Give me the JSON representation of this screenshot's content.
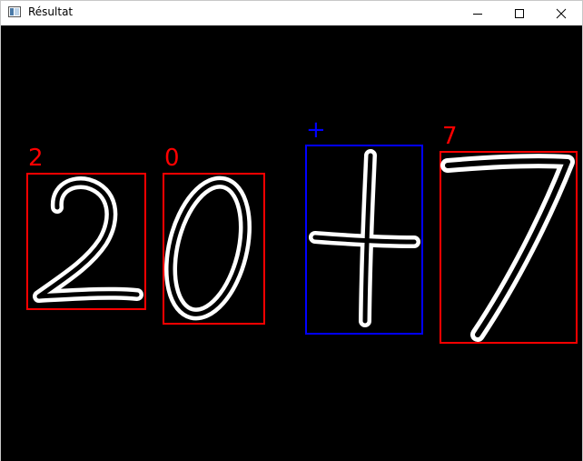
{
  "window": {
    "title": "Résultat",
    "icon": "window-app-icon",
    "controls": [
      "minimize-icon",
      "maximize-icon",
      "close-icon"
    ]
  },
  "detections": [
    {
      "label": "2",
      "color": "#ff0000"
    },
    {
      "label": "0",
      "color": "#ff0000"
    },
    {
      "label": "+",
      "color": "#0000ff"
    },
    {
      "label": "7",
      "color": "#ff0000"
    }
  ],
  "colors": {
    "canvas_background": "#000000",
    "stroke": "#ffffff",
    "digit_box": "#ff0000",
    "operator_box": "#0000ff"
  }
}
